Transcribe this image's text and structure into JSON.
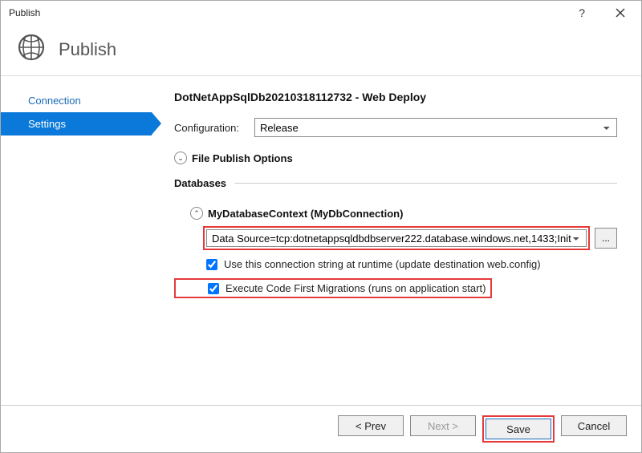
{
  "window": {
    "title": "Publish"
  },
  "header": {
    "title": "Publish"
  },
  "sidebar": {
    "items": [
      {
        "label": "Connection",
        "selected": false
      },
      {
        "label": "Settings",
        "selected": true
      }
    ]
  },
  "main": {
    "profile": "DotNetAppSqlDb20210318112732 - Web Deploy",
    "config_label": "Configuration:",
    "config_value": "Release",
    "file_options": "File Publish Options",
    "db_section": "Databases",
    "db_context": "MyDatabaseContext (MyDbConnection)",
    "conn_string": "Data Source=tcp:dotnetappsqldbdbserver222.database.windows.net,1433;Init",
    "chk_use": "Use this connection string at runtime (update destination web.config)",
    "chk_migrate": "Execute Code First Migrations (runs on application start)"
  },
  "footer": {
    "prev": "< Prev",
    "next": "Next >",
    "save": "Save",
    "cancel": "Cancel"
  }
}
